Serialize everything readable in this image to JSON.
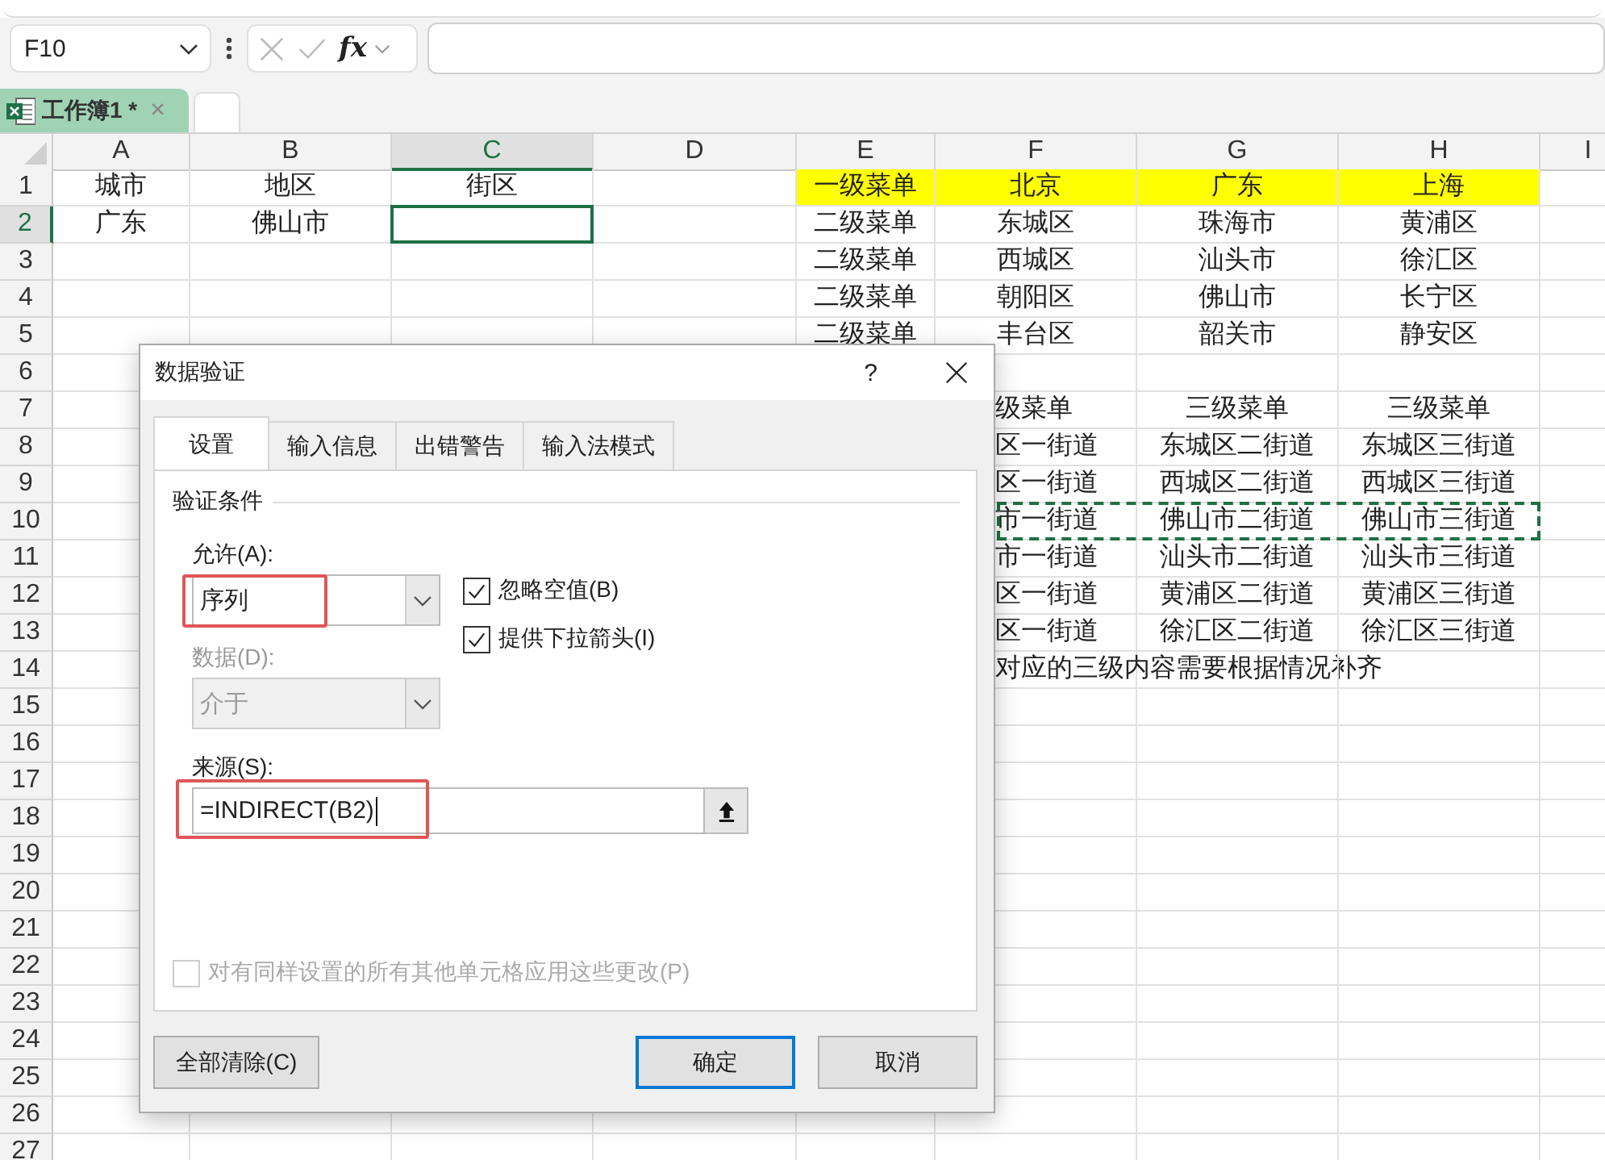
{
  "formula_bar": {
    "name_box": "F10",
    "fx": "fx"
  },
  "workbook_tabs": [
    {
      "label": "工作簿1 *",
      "selected": true,
      "close": "×"
    }
  ],
  "sheet": {
    "columns": [
      {
        "label": "A",
        "selected": false
      },
      {
        "label": "B",
        "selected": false
      },
      {
        "label": "C",
        "selected": true
      },
      {
        "label": "D",
        "selected": false
      },
      {
        "label": "E",
        "selected": false
      },
      {
        "label": "F",
        "selected": false
      },
      {
        "label": "G",
        "selected": false
      },
      {
        "label": "H",
        "selected": false
      },
      {
        "label": "I",
        "selected": false
      }
    ],
    "rows": [
      {
        "number": "1",
        "selected": false,
        "cells": [
          {
            "text": "城市"
          },
          {
            "text": "地区"
          },
          {
            "text": "街区"
          },
          {
            "text": ""
          },
          {
            "text": "一级菜单",
            "highlighted": true
          },
          {
            "text": "北京",
            "highlighted": true
          },
          {
            "text": "广东",
            "highlighted": true
          },
          {
            "text": "上海",
            "highlighted": true
          }
        ]
      },
      {
        "number": "2",
        "selected": true,
        "cells": [
          {
            "text": "广东"
          },
          {
            "text": "佛山市"
          },
          {
            "text": "",
            "active": true
          },
          {
            "text": ""
          },
          {
            "text": "二级菜单"
          },
          {
            "text": "东城区"
          },
          {
            "text": "珠海市"
          },
          {
            "text": "黄浦区"
          }
        ]
      },
      {
        "number": "3",
        "selected": false,
        "cells": [
          {
            "text": ""
          },
          {
            "text": ""
          },
          {
            "text": ""
          },
          {
            "text": ""
          },
          {
            "text": "二级菜单"
          },
          {
            "text": "西城区"
          },
          {
            "text": "汕头市"
          },
          {
            "text": "徐汇区"
          }
        ]
      },
      {
        "number": "4",
        "selected": false,
        "cells": [
          {
            "text": ""
          },
          {
            "text": ""
          },
          {
            "text": ""
          },
          {
            "text": ""
          },
          {
            "text": "二级菜单"
          },
          {
            "text": "朝阳区"
          },
          {
            "text": "佛山市"
          },
          {
            "text": "长宁区"
          }
        ]
      },
      {
        "number": "5",
        "selected": false,
        "cells": [
          {
            "text": ""
          },
          {
            "text": ""
          },
          {
            "text": ""
          },
          {
            "text": ""
          },
          {
            "text": "二级菜单"
          },
          {
            "text": "丰台区"
          },
          {
            "text": "韶关市"
          },
          {
            "text": "静安区"
          }
        ]
      },
      {
        "number": "6",
        "selected": false,
        "cells": []
      },
      {
        "number": "7",
        "selected": false,
        "cells": [
          {
            "text": ""
          },
          {
            "text": ""
          },
          {
            "text": ""
          },
          {
            "text": ""
          },
          {
            "text": ""
          },
          {
            "text": "级菜单"
          },
          {
            "text": "三级菜单"
          },
          {
            "text": "三级菜单"
          }
        ]
      },
      {
        "number": "8",
        "selected": false,
        "cells": [
          {
            "text": ""
          },
          {
            "text": ""
          },
          {
            "text": ""
          },
          {
            "text": ""
          },
          {
            "text": ""
          },
          {
            "text": "区一街道"
          },
          {
            "text": "东城区二街道"
          },
          {
            "text": "东城区三街道"
          }
        ]
      },
      {
        "number": "9",
        "selected": false,
        "cells": [
          {
            "text": ""
          },
          {
            "text": ""
          },
          {
            "text": ""
          },
          {
            "text": ""
          },
          {
            "text": ""
          },
          {
            "text": "区一街道"
          },
          {
            "text": "西城区二街道"
          },
          {
            "text": "西城区三街道"
          }
        ]
      },
      {
        "number": "10",
        "selected": false,
        "cells": [
          {
            "text": ""
          },
          {
            "text": ""
          },
          {
            "text": ""
          },
          {
            "text": ""
          },
          {
            "text": ""
          },
          {
            "text": "市一街道",
            "copied": true
          },
          {
            "text": "佛山市二街道",
            "copied": true
          },
          {
            "text": "佛山市三街道",
            "copied": true
          }
        ]
      },
      {
        "number": "11",
        "selected": false,
        "cells": [
          {
            "text": ""
          },
          {
            "text": ""
          },
          {
            "text": ""
          },
          {
            "text": ""
          },
          {
            "text": ""
          },
          {
            "text": "市一街道"
          },
          {
            "text": "汕头市二街道"
          },
          {
            "text": "汕头市三街道"
          }
        ]
      },
      {
        "number": "12",
        "selected": false,
        "cells": [
          {
            "text": ""
          },
          {
            "text": ""
          },
          {
            "text": ""
          },
          {
            "text": ""
          },
          {
            "text": ""
          },
          {
            "text": "区一街道"
          },
          {
            "text": "黄浦区二街道"
          },
          {
            "text": "黄浦区三街道"
          }
        ]
      },
      {
        "number": "13",
        "selected": false,
        "cells": [
          {
            "text": ""
          },
          {
            "text": ""
          },
          {
            "text": ""
          },
          {
            "text": ""
          },
          {
            "text": ""
          },
          {
            "text": "区一街道"
          },
          {
            "text": "徐汇区二街道"
          },
          {
            "text": "徐汇区三街道"
          }
        ]
      },
      {
        "number": "14",
        "selected": false,
        "cells": [
          {
            "text": ""
          },
          {
            "text": ""
          },
          {
            "text": ""
          },
          {
            "text": ""
          },
          {
            "text": ""
          },
          {
            "text": "对应的三级内容需要根据情况补齐"
          }
        ]
      },
      {
        "number": "15",
        "selected": false,
        "cells": []
      },
      {
        "number": "16",
        "selected": false,
        "cells": []
      },
      {
        "number": "17",
        "selected": false,
        "cells": []
      },
      {
        "number": "18",
        "selected": false,
        "cells": []
      },
      {
        "number": "19",
        "selected": false,
        "cells": []
      },
      {
        "number": "20",
        "selected": false,
        "cells": []
      },
      {
        "number": "21",
        "selected": false,
        "cells": []
      },
      {
        "number": "22",
        "selected": false,
        "cells": []
      },
      {
        "number": "23",
        "selected": false,
        "cells": []
      },
      {
        "number": "24",
        "selected": false,
        "cells": []
      },
      {
        "number": "25",
        "selected": false,
        "cells": []
      },
      {
        "number": "26",
        "selected": false,
        "cells": []
      },
      {
        "number": "27",
        "selected": false,
        "cells": []
      }
    ]
  },
  "dialog": {
    "title": "数据验证",
    "help": "?",
    "tabs": [
      {
        "label": "设置",
        "selected": true
      },
      {
        "label": "输入信息",
        "selected": false
      },
      {
        "label": "出错警告",
        "selected": false
      },
      {
        "label": "输入法模式",
        "selected": false
      }
    ],
    "group_title": "验证条件",
    "allow": {
      "label": "允许(A):",
      "value": "序列",
      "highlighted": true
    },
    "ignore_blank": {
      "label": "忽略空值(B)",
      "checked": true
    },
    "dropdown_arrow": {
      "label": "提供下拉箭头(I)",
      "checked": true
    },
    "data": {
      "label": "数据(D):",
      "value": "介于",
      "disabled": true
    },
    "source": {
      "label": "来源(S):",
      "value": "=INDIRECT(B2)",
      "highlighted": true
    },
    "apply_all": {
      "label": "对有同样设置的所有其他单元格应用这些更改(P)",
      "checked": false,
      "disabled": true
    },
    "buttons": [
      {
        "label": "全部清除(C)",
        "default": false
      },
      {
        "label": "确定",
        "default": true
      },
      {
        "label": "取消",
        "default": false
      }
    ]
  }
}
